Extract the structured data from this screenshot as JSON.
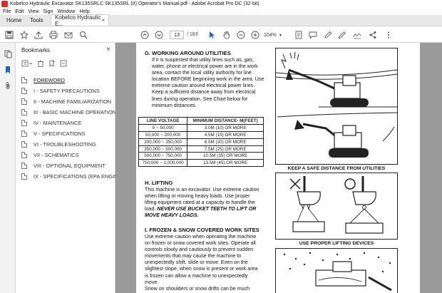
{
  "window": {
    "title": "Kobelco Hydraulic Excavator SK135SRLC SK135SRL (II) Operator's Manual.pdf - Adobe Acrobat Pro DC (32-bit)"
  },
  "menu": [
    "File",
    "Edit",
    "View",
    "Sign",
    "Window",
    "Help"
  ],
  "tabs": {
    "home": "Home",
    "tools": "Tools",
    "doc": "Kobelco Hydraulic E...",
    "doc_close": "×"
  },
  "toolbar": {
    "page_current": "13",
    "page_total": "/ 183",
    "zoom": "104%"
  },
  "bookmarks": {
    "title": "Bookmarks",
    "close": "×",
    "items": [
      "FOREWORD",
      "I - SAFETY PRECAUTIONS",
      "II - MACHINE FAMILIARIZATION",
      "III - BASIC MACHINE OPERATION",
      "IV - MAINTENANCE",
      "V - SPECIFICATIONS",
      "VI - TROUBLESHOOTING",
      "VII - SCHEMATICS",
      "VIII - OPTIONAL EQUIPMENT",
      "IX - SPECIFICATIONS (EPA ENGINE)"
    ]
  },
  "doc": {
    "sec_g_title": "G. WORKING AROUND UTILITIES",
    "sec_g_lines": [
      "If it is suspected that utility lines such as, gas,",
      "water, phone or electrical power are in the work",
      "area, contact the local utility authority for line",
      "location BEFORE beginning work in the area. Use",
      "extreme caution around electrical power lines.",
      "Keep a sufficient distance away from electrical",
      "lines during operation. See Chart below for",
      "minimum distances."
    ],
    "table_headers": [
      "LINE VOLTAGE",
      "MINIMUM DISTANCE- M(FEET)"
    ],
    "table_rows": [
      [
        "0 ~ 50,000",
        "3.0M (10) OR MORE"
      ],
      [
        "50,000 ~ 200,000",
        "4.5M (15) OR MORE"
      ],
      [
        "200,000 ~ 350,000",
        "6.0M (20) OR MORE"
      ],
      [
        "350,000 ~ 500,000",
        "7.5M (25) OR MORE"
      ],
      [
        "500,000 ~ 750,000",
        "10.5M (35) OR MORE"
      ],
      [
        "750,000 ~ 1,000,000",
        "13.5M (45) OR MORE"
      ]
    ],
    "sec_h_title": "H. LIFTING",
    "sec_h_lines": [
      "This machine is an excavator. Use extreme caution",
      "when lifting or moving heavy loads. Use proper",
      "lifting equipment rated at a capacity to handle the"
    ],
    "sec_h_line4_plain": "load.",
    "sec_h_line4_em": "NEVER USE BUCKET TEETH TO LIFT OR",
    "sec_h_line5_em": "MOVE HEAVY LOADS.",
    "sec_i_title": "I. FROZEN & SNOW COVERED WORK SITES",
    "sec_i_lines": [
      "Use extreme caution when operating the machine",
      "on frozen or snow covered work sites. Operate all",
      "controls slowly and cautiously to prevent sudden",
      "movements that may cause the machine to",
      "unexpectedly shift, slide or move. Even on the",
      "slightest slope, when snow is present or work area",
      "is frozen can allow a machine to unexpectedly",
      "move.",
      "Snow on shoulders or snow drifts can be much"
    ],
    "caption_1": "KEEP A SAFE DISTANCE FROM UTILITIES",
    "caption_2": "USE PROPER LIFTING DEVICES"
  }
}
